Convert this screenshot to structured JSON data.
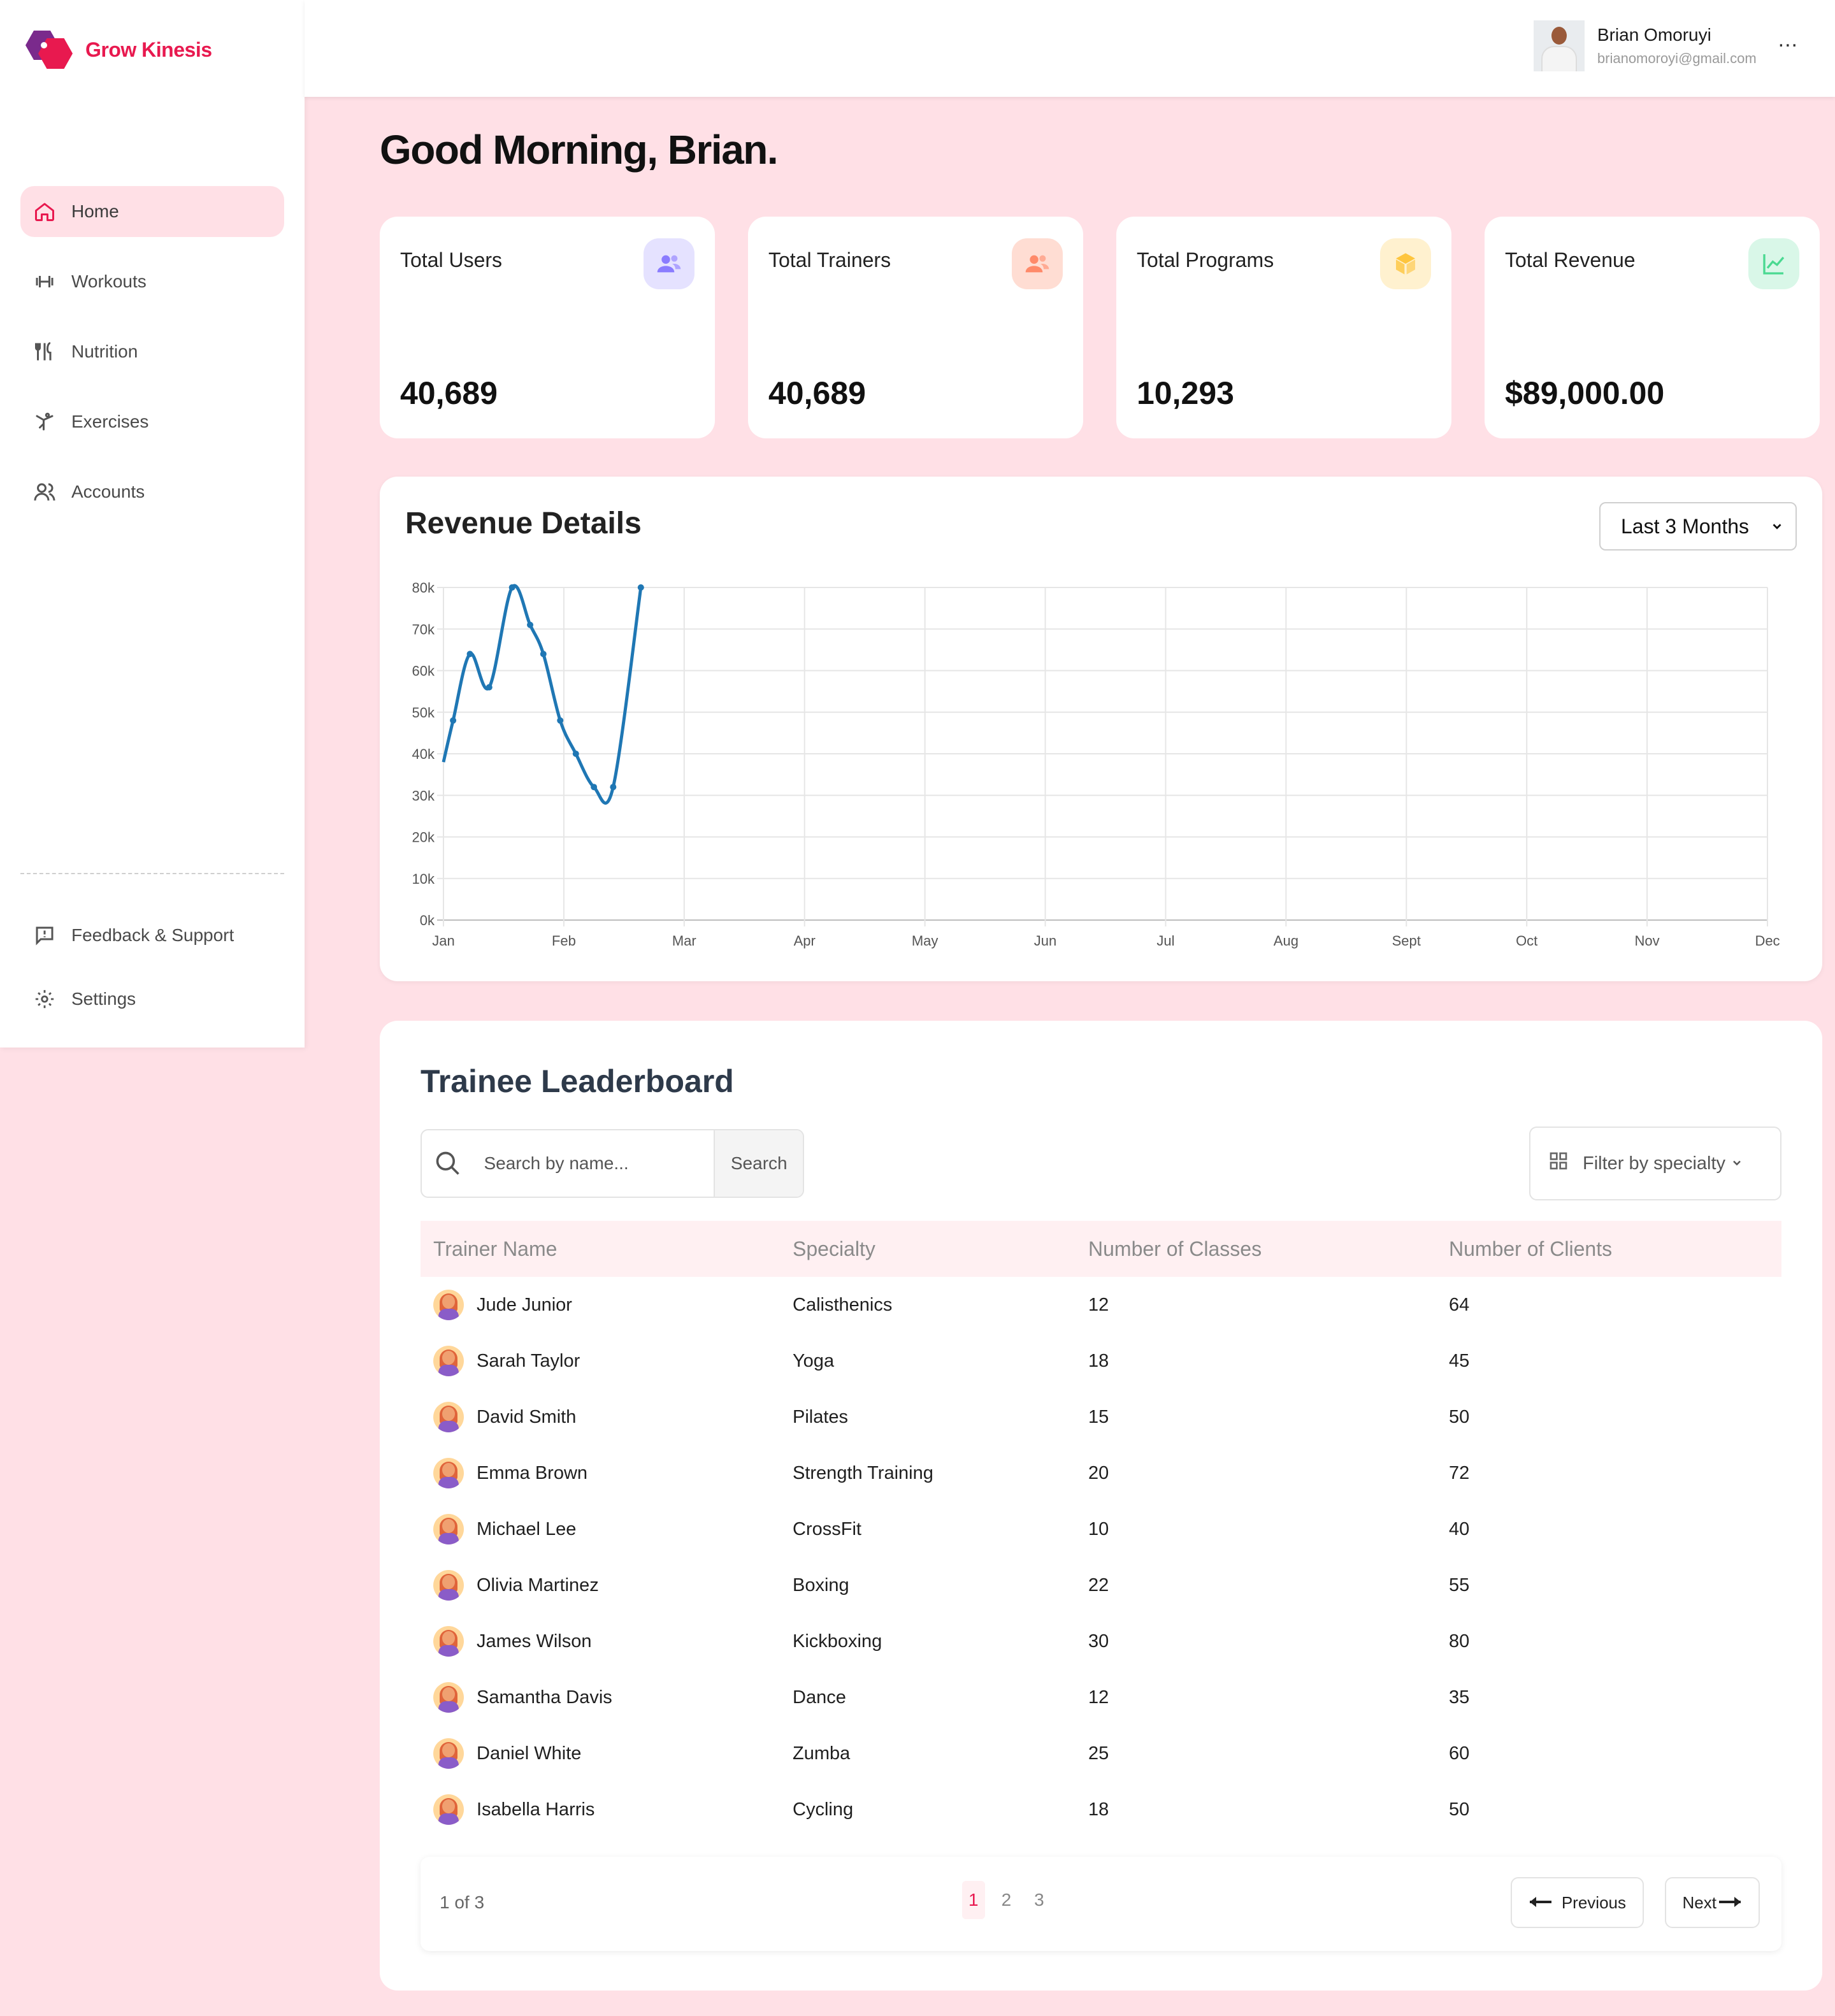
{
  "brand": {
    "name": "Grow Kinesis"
  },
  "nav": {
    "items": [
      {
        "label": "Home",
        "icon": "home-icon",
        "active": true
      },
      {
        "label": "Workouts",
        "icon": "dumbbell-icon"
      },
      {
        "label": "Nutrition",
        "icon": "utensils-icon"
      },
      {
        "label": "Exercises",
        "icon": "exercise-icon"
      },
      {
        "label": "Accounts",
        "icon": "users-icon"
      }
    ],
    "bottom": [
      {
        "label": "Feedback & Support",
        "icon": "feedback-icon"
      },
      {
        "label": "Settings",
        "icon": "gear-icon"
      }
    ]
  },
  "user": {
    "name": "Brian Omoruyi",
    "email": "brianomoroyi@gmail.com",
    "more": "..."
  },
  "greeting": "Good Morning, Brian.",
  "stats": [
    {
      "title": "Total Users",
      "value": "40,689",
      "icon": "users-icon",
      "color": "#8a7cff",
      "bg": "#e5e2ff"
    },
    {
      "title": "Total Trainers",
      "value": "40,689",
      "icon": "users-icon",
      "color": "#ff8a6a",
      "bg": "#ffddd3"
    },
    {
      "title": "Total Programs",
      "value": "10,293",
      "icon": "cube-icon",
      "color": "#fec53d",
      "bg": "#fff1cf"
    },
    {
      "title": "Total Revenue",
      "value": "$89,000.00",
      "icon": "chart-line-icon",
      "color": "#4ad991",
      "bg": "#d9f7e8"
    }
  ],
  "revenue": {
    "title": "Revenue Details",
    "range": "Last 3 Months"
  },
  "chart_data": {
    "type": "line",
    "title": "Revenue Details",
    "xlabel": "",
    "ylabel": "",
    "categories": [
      "Jan",
      "Feb",
      "Mar",
      "Apr",
      "May",
      "Jun",
      "Jul",
      "Aug",
      "Sept",
      "Oct",
      "Nov",
      "Dec"
    ],
    "yticks": [
      "0k",
      "10k",
      "20k",
      "30k",
      "40k",
      "50k",
      "60k",
      "70k",
      "80k"
    ],
    "ylim": [
      0,
      80000
    ],
    "grid": true,
    "color": "#1f77b4",
    "series": [
      {
        "x": [
          0.0,
          0.08,
          0.22,
          0.38,
          0.57,
          0.72,
          0.83,
          0.97,
          1.1,
          1.25,
          1.41,
          1.64
        ],
        "values": [
          38000,
          48000,
          64000,
          56000,
          80000,
          71000,
          64000,
          48000,
          40000,
          32000,
          32000,
          80000
        ]
      }
    ]
  },
  "leaderboard": {
    "title": "Trainee Leaderboard",
    "search_placeholder": "Search by name...",
    "search_button": "Search",
    "filter_label": "Filter by specialty",
    "columns": [
      "Trainer Name",
      "Specialty",
      "Number of Classes",
      "Number of Clients"
    ],
    "rows": [
      {
        "name": "Jude Junior",
        "specialty": "Calisthenics",
        "classes": "12",
        "clients": "64"
      },
      {
        "name": "Sarah Taylor",
        "specialty": "Yoga",
        "classes": "18",
        "clients": "45"
      },
      {
        "name": "David Smith",
        "specialty": "Pilates",
        "classes": "15",
        "clients": "50"
      },
      {
        "name": "Emma Brown",
        "specialty": "Strength Training",
        "classes": "20",
        "clients": "72"
      },
      {
        "name": "Michael Lee",
        "specialty": "CrossFit",
        "classes": "10",
        "clients": "40"
      },
      {
        "name": "Olivia Martinez",
        "specialty": "Boxing",
        "classes": "22",
        "clients": "55"
      },
      {
        "name": "James Wilson",
        "specialty": "Kickboxing",
        "classes": "30",
        "clients": "80"
      },
      {
        "name": "Samantha Davis",
        "specialty": "Dance",
        "classes": "12",
        "clients": "35"
      },
      {
        "name": "Daniel White",
        "specialty": "Zumba",
        "classes": "25",
        "clients": "60"
      },
      {
        "name": "Isabella Harris",
        "specialty": "Cycling",
        "classes": "18",
        "clients": "50"
      }
    ],
    "pagination": {
      "info": "1 of 3",
      "pages": [
        "1",
        "2",
        "3"
      ],
      "current": "1",
      "prev": "Previous",
      "next": "Next"
    }
  }
}
